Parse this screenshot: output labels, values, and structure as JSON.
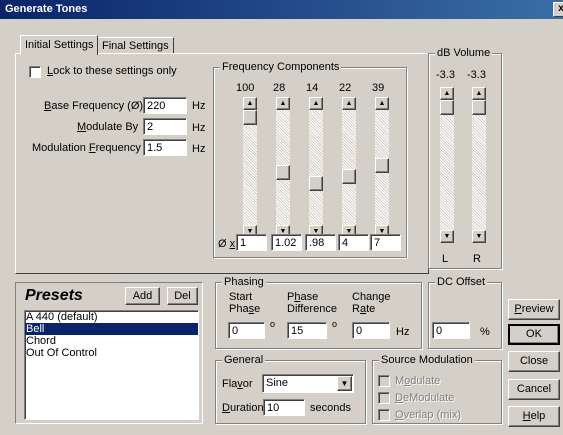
{
  "window": {
    "title": "Generate Tones",
    "close_glyph": "x"
  },
  "tabs": [
    "Initial Settings",
    "Final Settings"
  ],
  "lock": {
    "pre": "",
    "u": "L",
    "post": "ock to these settings only"
  },
  "base_freq": {
    "pre": "",
    "u": "B",
    "post": "ase Frequency (Ø)",
    "value": "220",
    "unit": "Hz"
  },
  "modulate_by": {
    "pre": "",
    "u": "M",
    "post": "odulate By",
    "value": "2",
    "unit": "Hz"
  },
  "mod_freq": {
    "pre": "Modulation ",
    "u": "F",
    "post": "requency",
    "value": "1.5",
    "unit": "Hz"
  },
  "freq_components": {
    "title": "Frequency Components",
    "levels": [
      "100",
      "28",
      "14",
      "22",
      "39"
    ],
    "multiplier_label_pre": "Ø ",
    "multiplier_label_u": "x",
    "multipliers": [
      "1",
      "1.02",
      ".98",
      "4",
      "7"
    ],
    "slider_positions": [
      0.0,
      0.55,
      0.66,
      0.59,
      0.48
    ]
  },
  "volume": {
    "title": "dB Volume",
    "levels": [
      "-3.3",
      "-3.3"
    ],
    "channels": [
      "L",
      "R"
    ],
    "slider_positions": [
      0.0,
      0.0
    ]
  },
  "presets": {
    "title": "Presets",
    "add_label": "Add",
    "del_label": "Del",
    "items": [
      "A 440 (default)",
      "Bell",
      "Chord",
      "Out Of Control"
    ],
    "selected_index": 1
  },
  "phasing": {
    "title": "Phasing",
    "start_line1": "Start",
    "start_line2_pre": "Pha",
    "start_line2_u": "s",
    "start_line2_post": "e",
    "diff_line1_pre": "P",
    "diff_line1_u": "h",
    "diff_line1_post": "ase",
    "diff_line2": "Difference",
    "rate_line1": "Change",
    "rate_line2_pre": "R",
    "rate_line2_u": "a",
    "rate_line2_post": "te",
    "start_value": "0",
    "diff_value": "15",
    "rate_value": "0",
    "degree": "o",
    "rate_unit": "Hz"
  },
  "dc_offset": {
    "title": "DC Offset",
    "value": "0",
    "unit": "%"
  },
  "general": {
    "title": "General",
    "flavor_pre": "Fla",
    "flavor_u": "v",
    "flavor_post": "or",
    "flavor_value": "Sine",
    "duration_pre": "",
    "duration_u": "D",
    "duration_post": "uration",
    "duration_value": "10",
    "duration_unit": "seconds"
  },
  "source_modulation": {
    "title": "Source Modulation",
    "modulate_pre": "M",
    "modulate_u": "o",
    "modulate_post": "dulate",
    "demodulate_pre": "",
    "demodulate_u": "D",
    "demodulate_post": "eModulate",
    "overlap_pre": "",
    "overlap_u": "O",
    "overlap_post": "verlap (mix)"
  },
  "buttons": {
    "preview_pre": "",
    "preview_u": "P",
    "preview_post": "review",
    "ok": "OK",
    "close": "Close",
    "cancel": "Cancel",
    "help_pre": "",
    "help_u": "H",
    "help_post": "elp"
  }
}
